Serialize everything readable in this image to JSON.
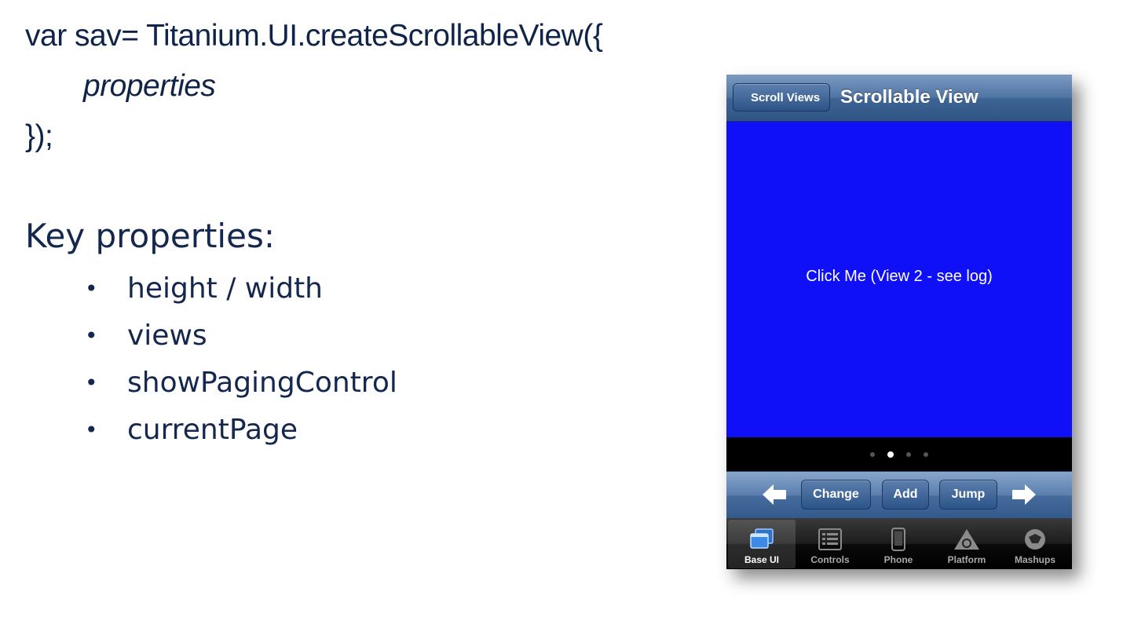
{
  "code": {
    "line1": "var sav= Titanium.UI.createScrollableView({",
    "line2": "properties",
    "line3": "});"
  },
  "key_properties": {
    "title": "Key properties:",
    "bullet": "•",
    "items": [
      "height / width",
      "views",
      "showPagingControl",
      "currentPage"
    ]
  },
  "phone": {
    "navbar": {
      "back_label": "Scroll Views",
      "title": "Scrollable View"
    },
    "content": {
      "label": "Click Me (View 2 - see log)",
      "background": "#1010f8"
    },
    "paging": {
      "page_count": 4,
      "current_page": 2
    },
    "toolbar": {
      "left_icon": "arrow-left-icon",
      "right_icon": "arrow-right-icon",
      "buttons": [
        "Change",
        "Add",
        "Jump"
      ]
    },
    "tabbar": {
      "tabs": [
        {
          "label": "Base UI",
          "icon": "windows-icon",
          "active": true
        },
        {
          "label": "Controls",
          "icon": "list-icon",
          "active": false
        },
        {
          "label": "Phone",
          "icon": "phone-icon",
          "active": false
        },
        {
          "label": "Platform",
          "icon": "platform-icon",
          "active": false
        },
        {
          "label": "Mashups",
          "icon": "mashups-icon",
          "active": false
        }
      ]
    }
  }
}
